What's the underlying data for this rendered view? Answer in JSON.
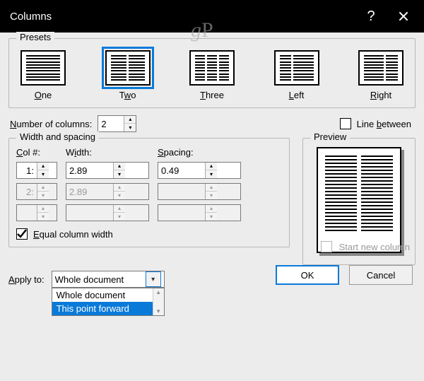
{
  "title": "Columns",
  "watermark": "gP",
  "presets": {
    "legend": "Presets",
    "items": [
      {
        "label": "One",
        "keyLetter": "O",
        "columns": [
          1
        ]
      },
      {
        "label": "Two",
        "keyLetter": "w",
        "columns": [
          1,
          1
        ],
        "selected": true
      },
      {
        "label": "Three",
        "keyLetter": "T",
        "columns": [
          1,
          1,
          1
        ]
      },
      {
        "label": "Left",
        "keyLetter": "L",
        "columns": [
          "narrow",
          "wide"
        ]
      },
      {
        "label": "Right",
        "keyLetter": "R",
        "columns": [
          "wide",
          "narrow"
        ]
      }
    ]
  },
  "numberOfColumns": {
    "label": "Number of columns:",
    "keyLetter": "N",
    "value": "2"
  },
  "lineBetween": {
    "label": "Line between",
    "keyLetter": "b",
    "checked": false
  },
  "widthSpacing": {
    "legend": "Width and spacing",
    "headers": {
      "col": "Col #:",
      "colKey": "C",
      "width": "Width:",
      "widthKey": "i",
      "spacing": "Spacing:",
      "spacingKey": "S"
    },
    "rows": [
      {
        "col": "1:",
        "width": "2.89\"",
        "spacing": "0.49\"",
        "enabled": true
      },
      {
        "col": "2:",
        "width": "2.89\"",
        "spacing": "",
        "enabled": false
      }
    ],
    "equal": {
      "label": "Equal column width",
      "keyLetter": "E",
      "checked": true
    }
  },
  "preview": {
    "legend": "Preview"
  },
  "applyTo": {
    "label": "Apply to:",
    "keyLetter": "A",
    "value": "Whole document",
    "options": [
      "Whole document",
      "This point forward"
    ],
    "highlightIndex": 1
  },
  "startNewColumn": {
    "label": "Start new column",
    "enabled": false
  },
  "buttons": {
    "ok": "OK",
    "cancel": "Cancel"
  }
}
